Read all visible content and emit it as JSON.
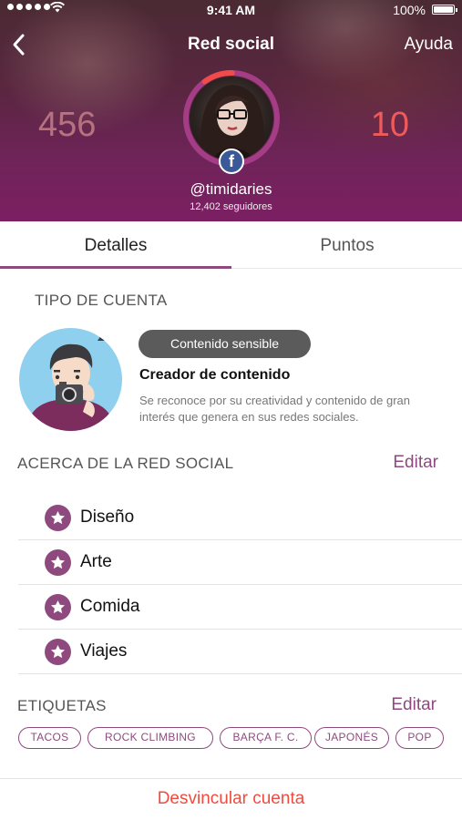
{
  "status_bar": {
    "time": "9:41 AM",
    "battery_percent": "100%",
    "signal_bars": 5,
    "battery_level": 1.0
  },
  "nav": {
    "back_icon": "chevron-left-icon",
    "title": "Red social",
    "help_label": "Ayuda"
  },
  "profile": {
    "stat_left": "456",
    "stat_right": "10",
    "username": "@timidaries",
    "followers": "12,402 seguidores",
    "network_icon": "facebook-icon",
    "network_badge_letter": "f",
    "ring_progress": 0.9
  },
  "tabs": [
    {
      "label": "Detalles",
      "active": true
    },
    {
      "label": "Puntos",
      "active": false
    }
  ],
  "account_type": {
    "section_title": "TIPO DE CUENTA",
    "badge": "Contenido sensible",
    "name": "Creador de contenido",
    "description": "Se reconoce por su creatividad y contenido de gran interés que genera en sus redes sociales."
  },
  "about": {
    "section_title": "ACERCA DE LA RED SOCIAL",
    "edit_label": "Editar",
    "items": [
      {
        "label": "Diseño",
        "icon": "star-icon"
      },
      {
        "label": "Arte",
        "icon": "star-icon"
      },
      {
        "label": "Comida",
        "icon": "star-icon"
      },
      {
        "label": "Viajes",
        "icon": "star-icon"
      }
    ]
  },
  "tags": {
    "section_title": "ETIQUETAS",
    "edit_label": "Editar",
    "items": [
      "TACOS",
      "ROCK CLIMBING",
      "BARÇA F. C.",
      "JAPONÉS",
      "POP"
    ]
  },
  "footer": {
    "unlink_label": "Desvincular cuenta"
  },
  "colors": {
    "accent": "#8e4a7e",
    "danger": "#ef4b3e",
    "facebook": "#3b5998"
  }
}
